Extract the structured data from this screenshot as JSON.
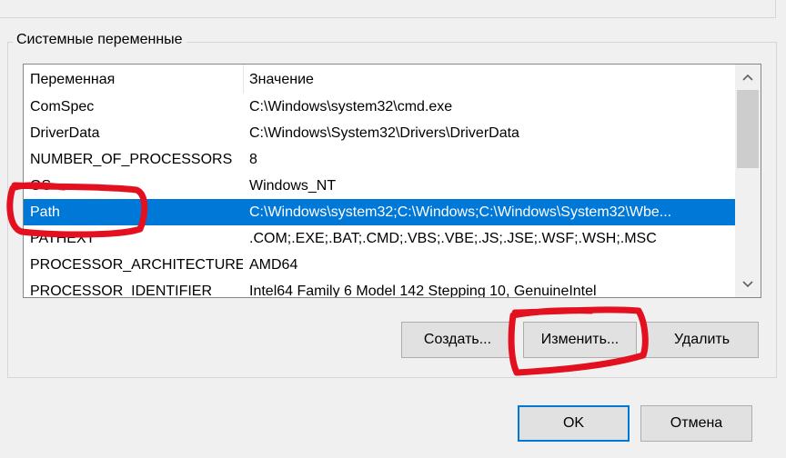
{
  "group": {
    "title": "Системные переменные"
  },
  "list": {
    "columns": {
      "name": "Переменная",
      "value": "Значение"
    },
    "rows": [
      {
        "name": "ComSpec",
        "value": "C:\\Windows\\system32\\cmd.exe"
      },
      {
        "name": "DriverData",
        "value": "C:\\Windows\\System32\\Drivers\\DriverData"
      },
      {
        "name": "NUMBER_OF_PROCESSORS",
        "value": "8"
      },
      {
        "name": "OS",
        "value": "Windows_NT"
      },
      {
        "name": "Path",
        "value": "C:\\Windows\\system32;C:\\Windows;C:\\Windows\\System32\\Wbe..."
      },
      {
        "name": "PATHEXT",
        "value": ".COM;.EXE;.BAT;.CMD;.VBS;.VBE;.JS;.JSE;.WSF;.WSH;.MSC"
      },
      {
        "name": "PROCESSOR_ARCHITECTURE",
        "value": "AMD64"
      },
      {
        "name": "PROCESSOR_IDENTIFIER",
        "value": "Intel64 Family 6 Model 142 Stepping 10, GenuineIntel"
      }
    ],
    "selected_index": 4
  },
  "buttons": {
    "create": "Создать...",
    "edit": "Изменить...",
    "delete": "Удалить",
    "ok": "OK",
    "cancel": "Отмена"
  },
  "colors": {
    "selection": "#0078d7",
    "annotation": "#e3101f"
  },
  "icons": {
    "scroll_up": "chevron-up-icon",
    "scroll_down": "chevron-down-icon"
  }
}
